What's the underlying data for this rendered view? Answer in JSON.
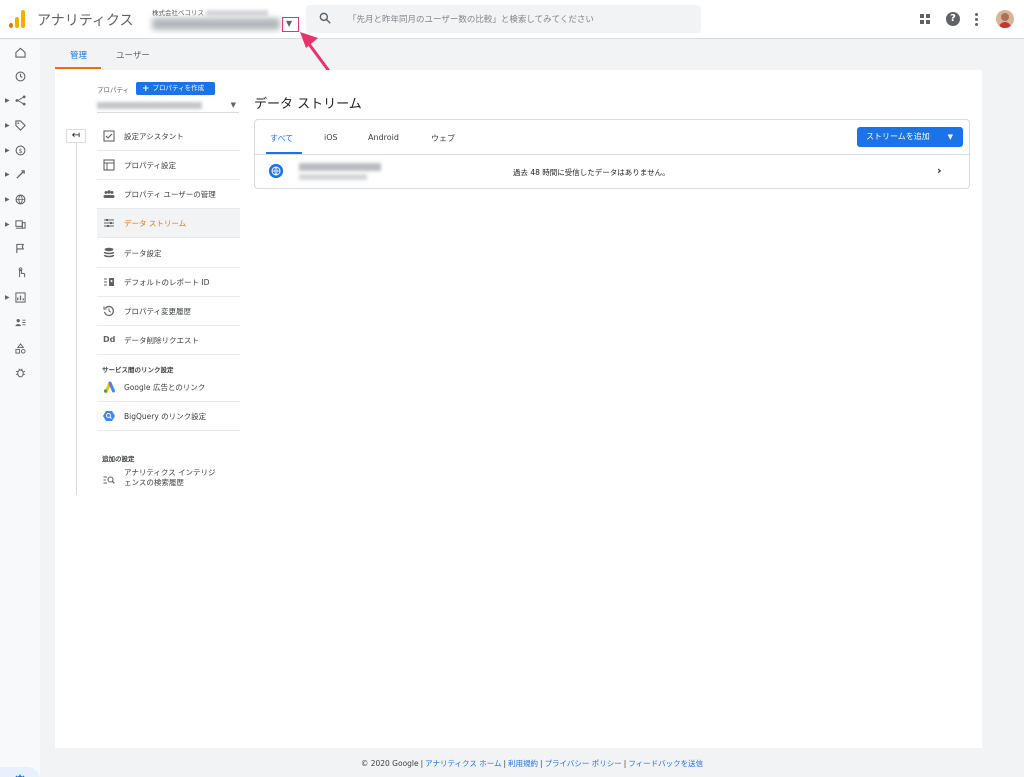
{
  "app": {
    "title": "アナリティクス",
    "account_prefix": "株式会社ベコリス",
    "brand_color": "#f9ab00"
  },
  "search": {
    "placeholder": "「先月と昨年同月のユーザー数の比較」と検索してみてください"
  },
  "top_tabs": [
    {
      "label": "管理",
      "active": true
    },
    {
      "label": "ユーザー",
      "active": false
    }
  ],
  "property_panel": {
    "label": "プロパティ",
    "create_button": "プロパティを作成",
    "menu": [
      {
        "label": "設定アシスタント",
        "icon": "checklist-icon"
      },
      {
        "label": "プロパティ設定",
        "icon": "window-icon"
      },
      {
        "label": "プロパティ ユーザーの管理",
        "icon": "people-icon"
      },
      {
        "label": "データ ストリーム",
        "icon": "streams-icon",
        "active": true
      },
      {
        "label": "データ設定",
        "icon": "database-icon"
      },
      {
        "label": "デフォルトのレポート ID",
        "icon": "report-id-icon"
      },
      {
        "label": "プロパティ変更履歴",
        "icon": "history-icon"
      },
      {
        "label": "データ削除リクエスト",
        "icon": "data-deletion-icon"
      }
    ],
    "sections": {
      "linking": {
        "title": "サービス間のリンク設定",
        "items": [
          {
            "label": "Google 広告とのリンク",
            "icon": "google-ads-icon"
          },
          {
            "label": "BigQuery のリンク設定",
            "icon": "bigquery-icon"
          }
        ]
      },
      "additional": {
        "title": "追加の設定",
        "items": [
          {
            "label_line1": "アナリティクス インテリジ",
            "label_line2": "ェンスの検索履歴",
            "icon": "search-history-icon"
          }
        ]
      }
    }
  },
  "data_streams": {
    "title": "データ ストリーム",
    "tabs": [
      {
        "label": "すべて",
        "active": true
      },
      {
        "label": "iOS",
        "active": false
      },
      {
        "label": "Android",
        "active": false
      },
      {
        "label": "ウェブ",
        "active": false
      }
    ],
    "add_button": "ストリームを追加",
    "rows": [
      {
        "status": "過去 48 時間に受信したデータはありません。",
        "icon": "globe-icon"
      }
    ]
  },
  "footer": {
    "copyright": "© 2020 Google",
    "links": [
      "アナリティクス ホーム",
      "利用規約",
      "プライバシー ポリシー",
      "フィードバックを送信"
    ]
  },
  "colors": {
    "accent_blue": "#1a73e8",
    "active_orange": "#e8710a",
    "annotation_pink": "#e8336d"
  }
}
